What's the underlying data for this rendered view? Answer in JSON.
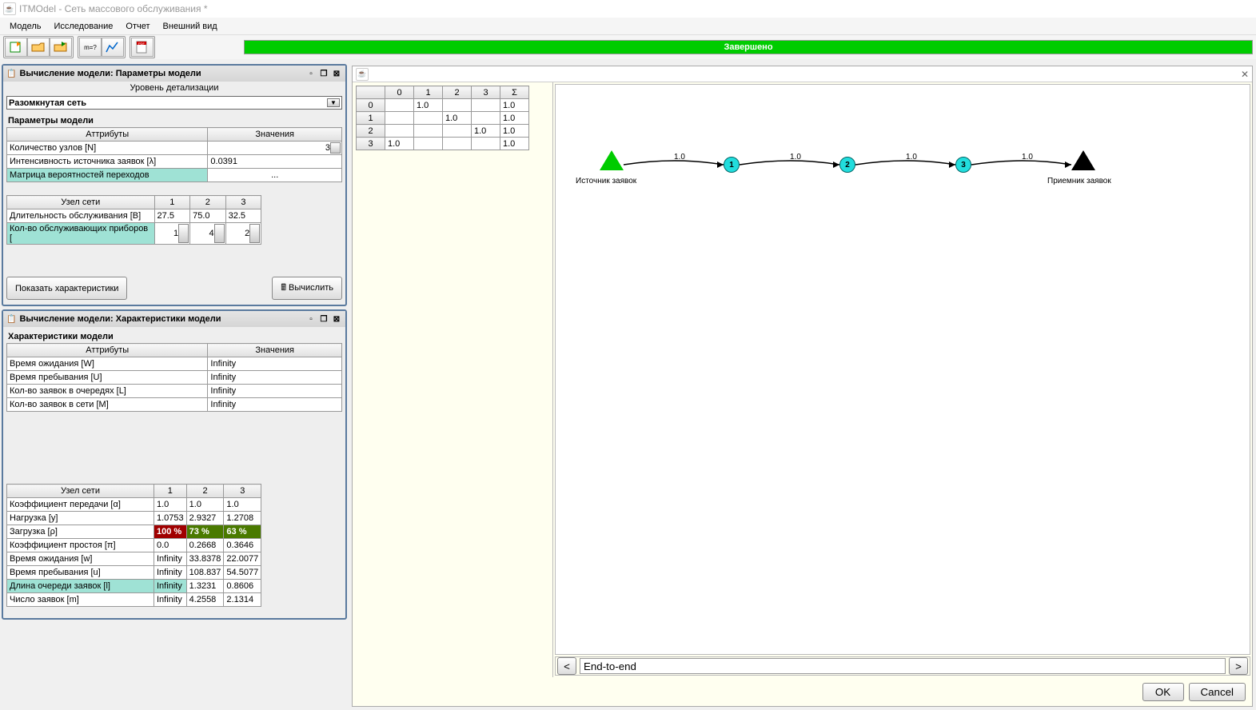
{
  "app": {
    "title": "ITMOdel - Сеть массового обслуживания *"
  },
  "menu": {
    "m0": "Модель",
    "m1": "Исследование",
    "m2": "Отчет",
    "m3": "Внешний вид"
  },
  "toolbar": {
    "progress_text": "Завершено"
  },
  "panel_params": {
    "title": "Вычисление модели: Параметры модели",
    "detail_label": "Уровень детализации",
    "network_type": "Разомкнутая сеть",
    "section": "Параметры модели",
    "col_attr": "Аттрибуты",
    "col_val": "Значения",
    "attr_nodes": "Количество узлов [N]",
    "val_nodes": "3",
    "attr_lambda": "Интенсивность источника заявок [λ]",
    "val_lambda": "0.0391",
    "attr_matrix": "Матрица вероятностей переходов",
    "val_matrix": "...",
    "col_net": "Узел сети",
    "col_1": "1",
    "col_2": "2",
    "col_3": "3",
    "row_svc": "Длительность обслуживания [B]",
    "svc1": "27.5",
    "svc2": "75.0",
    "svc3": "32.5",
    "row_dev": "Кол-во обслуживающих приборов [",
    "dev1": "1",
    "dev2": "4",
    "dev3": "2",
    "btn_show": "Показать характеристики",
    "btn_calc": "Вычислить"
  },
  "panel_chars": {
    "title": "Вычисление модели: Характеристики модели",
    "section": "Характеристики модели",
    "col_attr": "Аттрибуты",
    "col_val": "Значения",
    "row_W": "Время ожидания [W]",
    "val_W": "Infinity",
    "row_U": "Время пребывания [U]",
    "val_U": "Infinity",
    "row_L": "Кол-во заявок в очередях [L]",
    "val_L": "Infinity",
    "row_M": "Кол-во заявок в сети [M]",
    "val_M": "Infinity",
    "col_net": "Узел сети",
    "col_1": "1",
    "col_2": "2",
    "col_3": "3",
    "r_alpha": "Коэффициент передачи [α]",
    "a1": "1.0",
    "a2": "1.0",
    "a3": "1.0",
    "r_y": "Нагрузка [y]",
    "y1": "1.0753",
    "y2": "2.9327",
    "y3": "1.2708",
    "r_rho": "Загрузка [ρ]",
    "rho1": "100 %",
    "rho2": "73 %",
    "rho3": "63 %",
    "r_pi": "Коэффициент простоя [π]",
    "pi1": "0.0",
    "pi2": "0.2668",
    "pi3": "0.3646",
    "r_w": "Время ожидания [w]",
    "w1": "Infinity",
    "w2": "33.8378",
    "w3": "22.0077",
    "r_u": "Время пребывания [u]",
    "u1": "Infinity",
    "u2": "108.837",
    "u3": "54.5077",
    "r_l": "Длина очереди заявок [l]",
    "l1": "Infinity",
    "l2": "1.3231",
    "l3": "0.8606",
    "r_m": "Число заявок [m]",
    "m1": "Infinity",
    "m2": "4.2558",
    "m3": "2.1314"
  },
  "matrix": {
    "cols": [
      "0",
      "1",
      "2",
      "3",
      "Σ"
    ],
    "rows": [
      {
        "h": "0",
        "c": [
          "",
          "1.0",
          "",
          "",
          "1.0"
        ]
      },
      {
        "h": "1",
        "c": [
          "",
          "",
          "1.0",
          "",
          "1.0"
        ]
      },
      {
        "h": "2",
        "c": [
          "",
          "",
          "",
          "1.0",
          "1.0"
        ]
      },
      {
        "h": "3",
        "c": [
          "1.0",
          "",
          "",
          "",
          "1.0"
        ]
      }
    ]
  },
  "graph": {
    "src_label": "Источник заявок",
    "dst_label": "Приемник заявок",
    "nav_value": "End-to-end",
    "nav_prev": "<",
    "nav_next": ">",
    "e1": "1.0",
    "e2": "1.0",
    "e3": "1.0",
    "e4": "1.0",
    "n1": "1",
    "n2": "2",
    "n3": "3"
  },
  "dialog": {
    "ok": "OK",
    "cancel": "Cancel"
  }
}
